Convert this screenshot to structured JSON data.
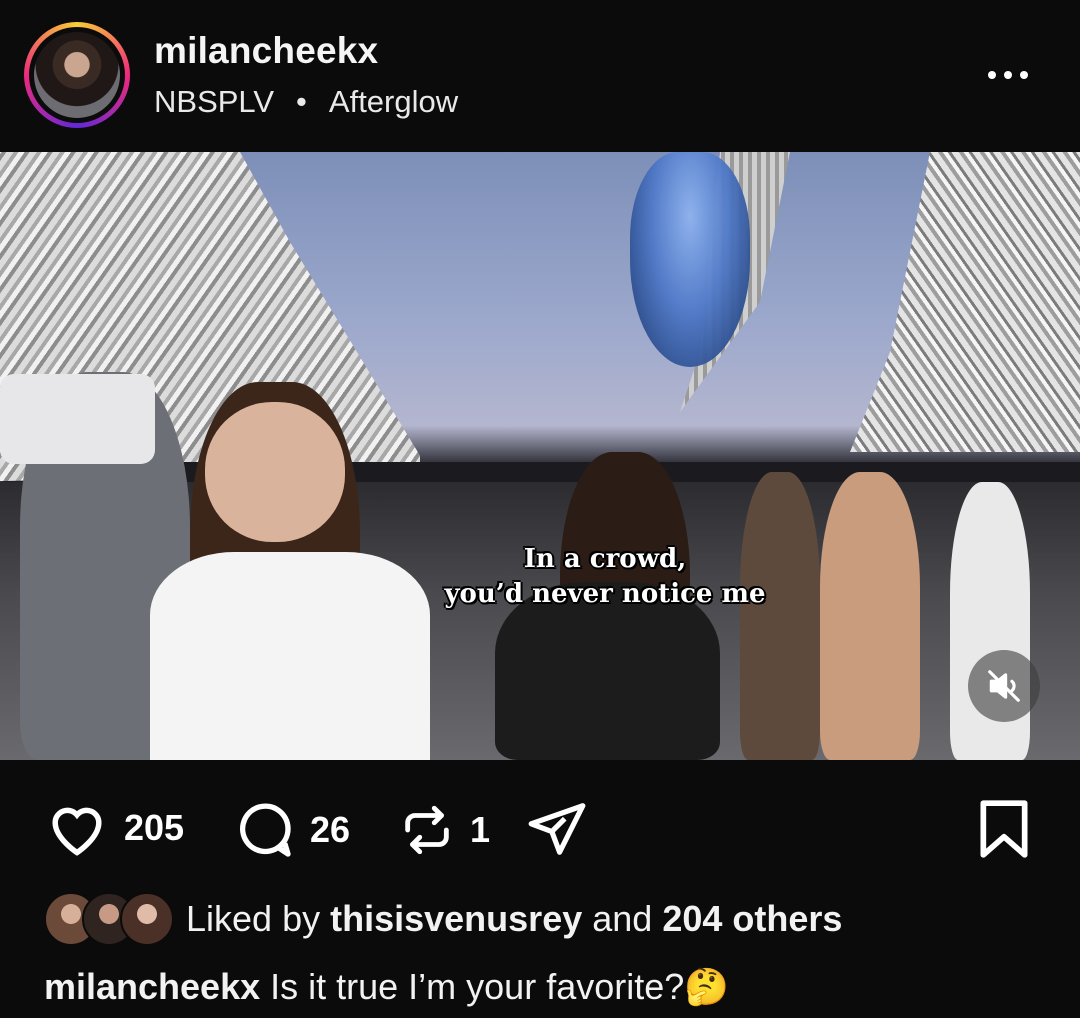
{
  "post": {
    "username": "milancheekx",
    "audio": {
      "artist": "NBSPLV",
      "separator": "•",
      "track": "Afterglow"
    },
    "media": {
      "caption_line1": "In a crowd,",
      "caption_line2": "you’d never notice me",
      "muted": true
    },
    "stats": {
      "likes": "205",
      "comments": "26",
      "reposts": "1"
    },
    "liked_by": {
      "prefix": "Liked by",
      "user": "thisisvenusrey",
      "and": "and",
      "others": "204 others"
    },
    "caption": {
      "username": "milancheekx",
      "text": "Is it true I’m your favorite?🤔"
    }
  },
  "icons": [
    "more-horizontal-icon",
    "mute-icon",
    "heart-icon",
    "comment-icon",
    "repost-icon",
    "share-icon",
    "bookmark-icon"
  ],
  "colors": {
    "background": "#0b0b0c",
    "text": "#f5f5f5",
    "ring_start": "#f9ce34",
    "ring_mid": "#ee2a7b",
    "ring_end": "#6228d7"
  }
}
